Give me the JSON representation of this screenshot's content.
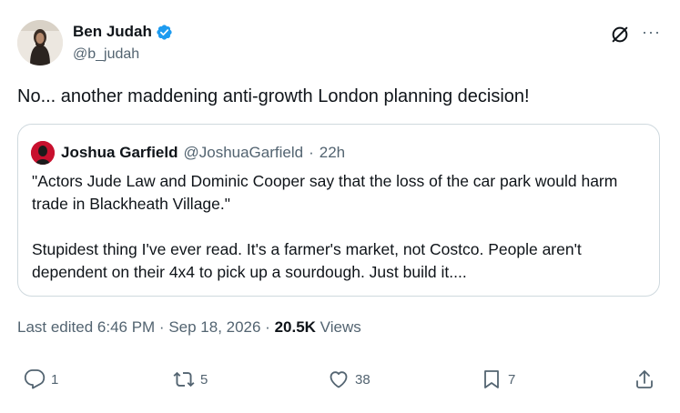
{
  "author": {
    "name": "Ben Judah",
    "handle": "@b_judah"
  },
  "tweet_text": "No... another maddening anti-growth London planning decision!",
  "quote": {
    "name": "Joshua Garfield",
    "handle": "@JoshuaGarfield",
    "separator": "·",
    "time": "22h",
    "text": "\"Actors Jude Law and Dominic Cooper say that the loss of the car park would harm trade in Blackheath Village.\"\n\nStupidest thing I've ever read. It's a farmer's market, not Costco. People aren't dependent on their 4x4 to pick up a sourdough. Just build it...."
  },
  "meta": {
    "edited": "Last edited 6:46 PM · Sep 18, 2026 · ",
    "views_count": "20.5K",
    "views_label": " Views"
  },
  "actions": {
    "replies": "1",
    "reposts": "5",
    "likes": "38",
    "bookmarks": "7"
  },
  "menu_glyph": "···",
  "colors": {
    "verified": "#1d9bf0",
    "secondary_text": "#536471",
    "border": "#cfd9de"
  }
}
